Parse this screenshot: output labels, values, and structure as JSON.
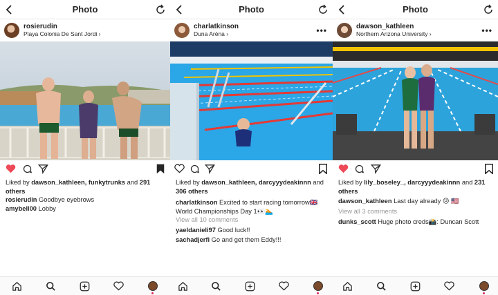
{
  "colors": {
    "like_red": "#ed4956",
    "text": "#262626",
    "muted": "#999999",
    "pool_blue": "#2aa6e8"
  },
  "panels": [
    {
      "title": "Photo",
      "username": "rosierudin",
      "location": "Playa Colonia De Sant Jordi",
      "liked": true,
      "saved": true,
      "likes_prefix": "Liked by ",
      "likes_users": "dawson_kathleen, funkytrunks",
      "likes_mid": " and ",
      "likes_count": "291 others",
      "caption_user": "rosierudin",
      "caption_text": " Goodbye eyebrows",
      "view_all": "",
      "comments": [
        {
          "user": "amybell00",
          "text": " Lobby"
        }
      ]
    },
    {
      "title": "Photo",
      "username": "charlatkinson",
      "location": "Duna Aréna",
      "liked": false,
      "saved": false,
      "likes_prefix": "Liked by ",
      "likes_users": "dawson_kathleen, darcyyydeakinnn",
      "likes_mid": " and ",
      "likes_count": "306 others",
      "caption_user": "charlatkinson",
      "caption_text": " Excited to start racing tomorrow🇬🇧 World Championships Day 1👀🏊",
      "view_all": "View all 10 comments",
      "comments": [
        {
          "user": "yaeldanieli97",
          "text": " Good luck!!"
        },
        {
          "user": "sachadjerfi",
          "text": " Go and get them Eddy!!!"
        }
      ]
    },
    {
      "title": "Photo",
      "username": "dawson_kathleen",
      "location": "Northern Arizona University",
      "liked": true,
      "saved": false,
      "likes_prefix": "Liked by ",
      "likes_users": "lily_boseley_, darcyyydeakinnn",
      "likes_mid": " and ",
      "likes_count": "231 others",
      "caption_user": "dawson_kathleen",
      "caption_text": " Last day already 😢 🇺🇸",
      "view_all": "View all 3 comments",
      "comments": [
        {
          "user": "dunks_scott",
          "text": " Huge photo creds📸: Duncan Scott"
        }
      ]
    }
  ],
  "nav_icons": [
    "home-icon",
    "search-icon",
    "new-post-icon",
    "activity-heart-icon",
    "profile-avatar"
  ]
}
